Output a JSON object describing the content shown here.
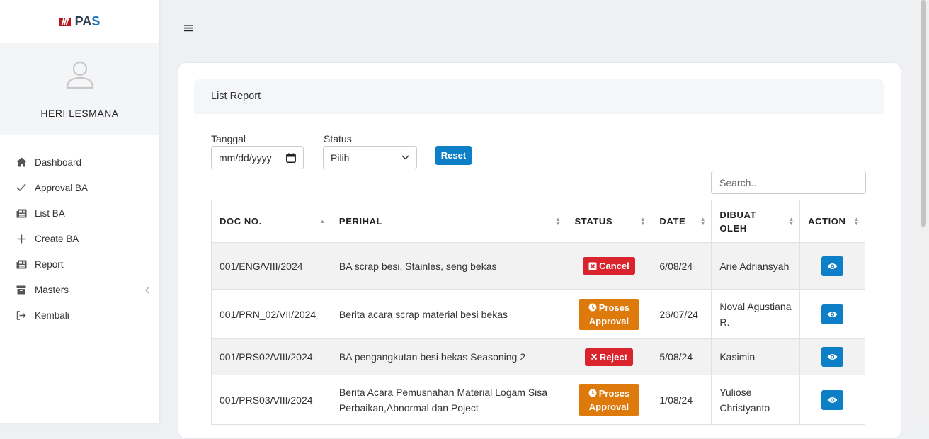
{
  "brand": {
    "text_1": "PA",
    "text_2": "S"
  },
  "user": {
    "name": "HERI LESMANA"
  },
  "sidebar": {
    "items": [
      {
        "label": "Dashboard",
        "icon": "house-icon"
      },
      {
        "label": "Approval BA",
        "icon": "check-icon"
      },
      {
        "label": "List BA",
        "icon": "newspaper-icon"
      },
      {
        "label": "Create BA",
        "icon": "plus-icon"
      },
      {
        "label": "Report",
        "icon": "newspaper-icon"
      },
      {
        "label": "Masters",
        "icon": "archive-icon"
      },
      {
        "label": "Kembali",
        "icon": "sign-out-icon"
      }
    ]
  },
  "card": {
    "title": "List Report"
  },
  "filters": {
    "tanggal_label": "Tanggal",
    "tanggal_placeholder": "mm/dd/yyyy",
    "status_label": "Status",
    "status_value": "Pilih",
    "reset_label": "Reset",
    "search_placeholder": "Search.."
  },
  "table": {
    "headers": [
      "DOC NO.",
      "PERIHAL",
      "STATUS",
      "DATE",
      "DIBUAT OLEH",
      "ACTION"
    ],
    "rows": [
      {
        "doc_no": "001/ENG/VIII/2024",
        "perihal": "BA scrap besi, Stainles, seng bekas",
        "status": "Cancel",
        "date": "6/08/24",
        "dibuat_oleh": "Arie Adriansyah"
      },
      {
        "doc_no": "001/PRN_02/VII/2024",
        "perihal": "Berita acara scrap material besi bekas",
        "status_line1": "Proses",
        "status_line2": "Approval",
        "date": "26/07/24",
        "dibuat_oleh": "Noval Agustiana R."
      },
      {
        "doc_no": "001/PRS02/VIII/2024",
        "perihal": "BA pengangkutan besi bekas Seasoning 2",
        "status": "Reject",
        "date": "5/08/24",
        "dibuat_oleh": "Kasimin"
      },
      {
        "doc_no": "001/PRS03/VIII/2024",
        "perihal": "Berita Acara Pemusnahan Material Logam Sisa Perbaikan,Abnormal dan Poject",
        "status_line1": "Proses",
        "status_line2": "Approval",
        "date": "1/08/24",
        "dibuat_oleh": "Yuliose Christyanto"
      }
    ]
  },
  "colors": {
    "primary": "#0d7fc7",
    "danger": "#d9242d",
    "warning": "#dd7a0b"
  }
}
